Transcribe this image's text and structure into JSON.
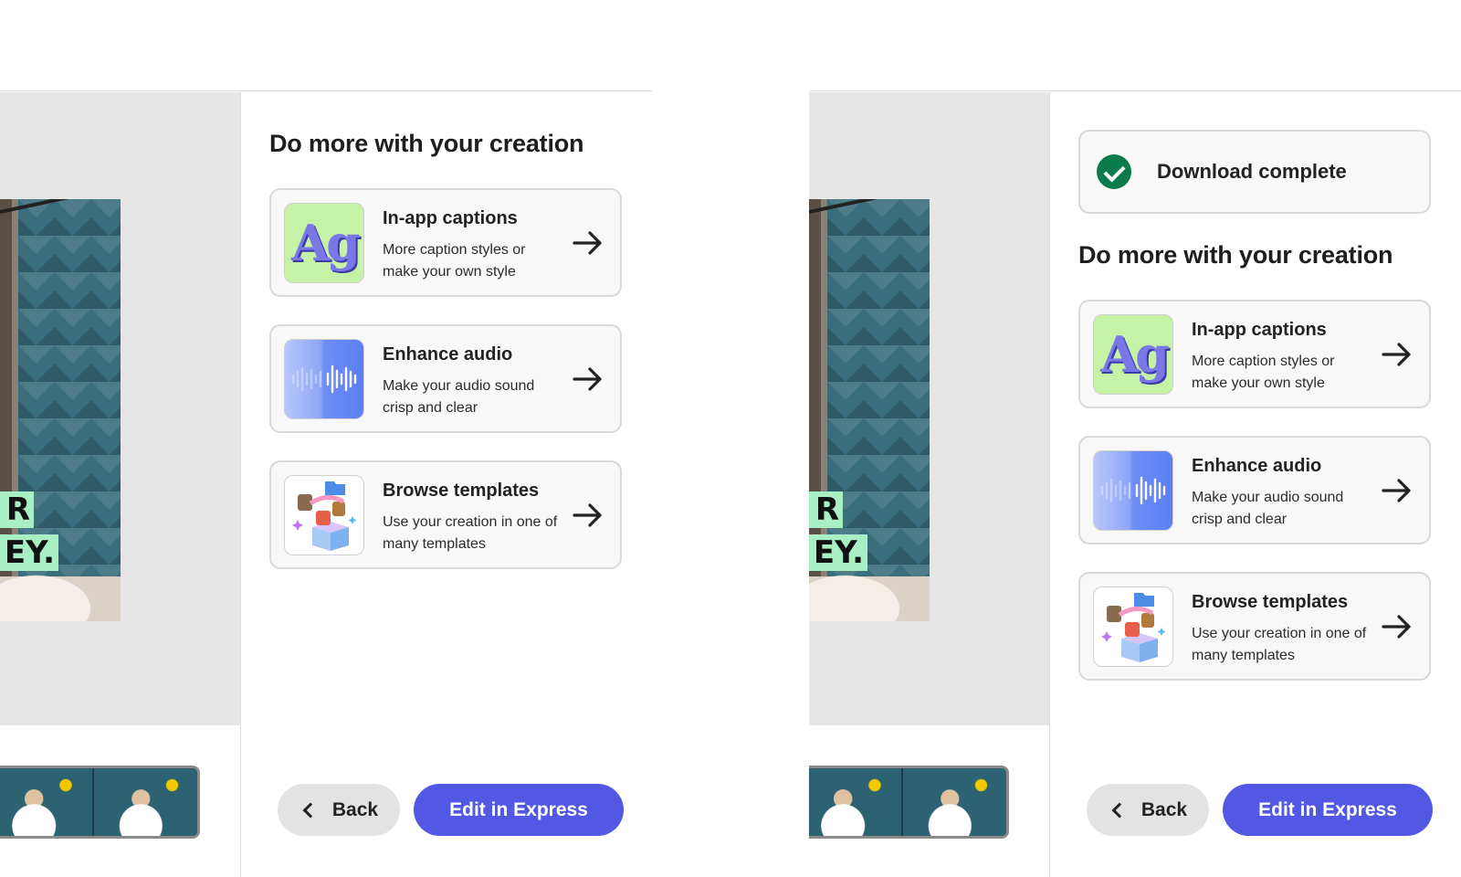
{
  "frames": [
    {
      "preview": {
        "caption_line1": "R",
        "caption_line2": "EY."
      },
      "panel": {
        "toast": null,
        "heading": "Do more with your creation",
        "cards": [
          {
            "title": "In-app captions",
            "desc": "More caption styles or make your own style",
            "icon": "captions-ag-icon"
          },
          {
            "title": "Enhance audio",
            "desc": "Make your audio sound crisp and clear",
            "icon": "audio-waveform-icon"
          },
          {
            "title": "Browse templates",
            "desc": "Use your creation in one of many templates",
            "icon": "templates-icon"
          }
        ],
        "back_label": "Back",
        "primary_label": "Edit in Express"
      }
    },
    {
      "preview": {
        "caption_line1": "R",
        "caption_line2": "EY."
      },
      "panel": {
        "toast": "Download complete",
        "heading": "Do more with your creation",
        "cards": [
          {
            "title": "In-app captions",
            "desc": "More caption styles or make your own style",
            "icon": "captions-ag-icon"
          },
          {
            "title": "Enhance audio",
            "desc": "Make your audio sound crisp and clear",
            "icon": "audio-waveform-icon"
          },
          {
            "title": "Browse templates",
            "desc": "Use your creation in one of many templates",
            "icon": "templates-icon"
          }
        ],
        "back_label": "Back",
        "primary_label": "Edit in Express"
      }
    }
  ],
  "colors": {
    "primary": "#5258e4",
    "success": "#0b7a4d",
    "caption_bg": "#a8efc4",
    "ag_tile": "#c6f2a8"
  }
}
